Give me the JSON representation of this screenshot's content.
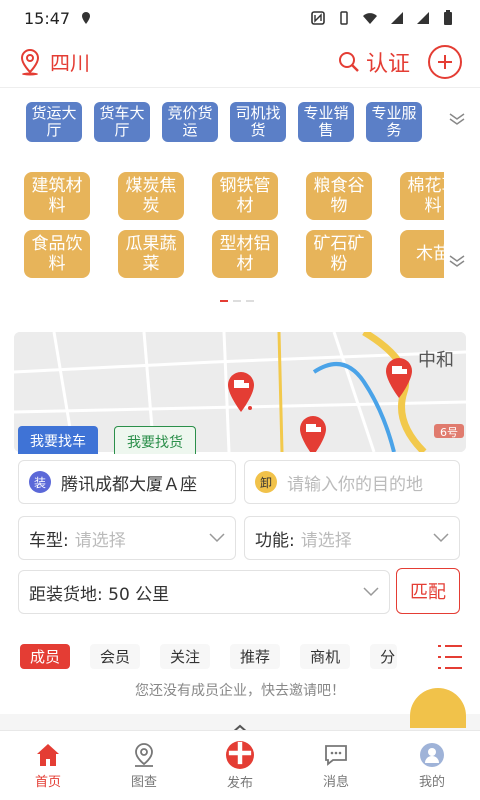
{
  "status": {
    "time": "15:47"
  },
  "header": {
    "city": "四川",
    "cert_label": "认证"
  },
  "blue_categories": [
    "货运大厅",
    "货车大厅",
    "竞价货运",
    "司机找货",
    "专业销售",
    "专业服务"
  ],
  "gold_categories": [
    "建筑材料",
    "煤炭焦炭",
    "钢铁管材",
    "粮食谷物",
    "棉花草料",
    "食品饮料",
    "瓜果蔬菜",
    "型材铝材",
    "矿石矿粉",
    "木苗"
  ],
  "map": {
    "place_label": "中和",
    "road_tag": "6号"
  },
  "tabs": {
    "find_truck": "我要找车",
    "find_cargo": "我要找货"
  },
  "form": {
    "origin_badge": "装",
    "origin": "腾讯成都大厦Ａ座",
    "dest_badge": "卸",
    "dest_placeholder": "请输入你的目的地",
    "truck_type_label": "车型:",
    "truck_type_placeholder": "请选择",
    "function_label": "功能:",
    "function_placeholder": "请选择",
    "distance": "距装货地: 50 公里",
    "match_button": "匹配"
  },
  "members": {
    "tabs": [
      "成员",
      "会员",
      "关注",
      "推荐",
      "商机",
      "分"
    ],
    "empty_text": "您还没有成员企业，快去邀请吧！"
  },
  "nav": {
    "items": [
      "首页",
      "图查",
      "发布",
      "消息",
      "我的"
    ]
  },
  "colors": {
    "accent": "#e43d34",
    "blue_btn": "#5b7fc7",
    "gold_btn": "#e7b45a"
  }
}
